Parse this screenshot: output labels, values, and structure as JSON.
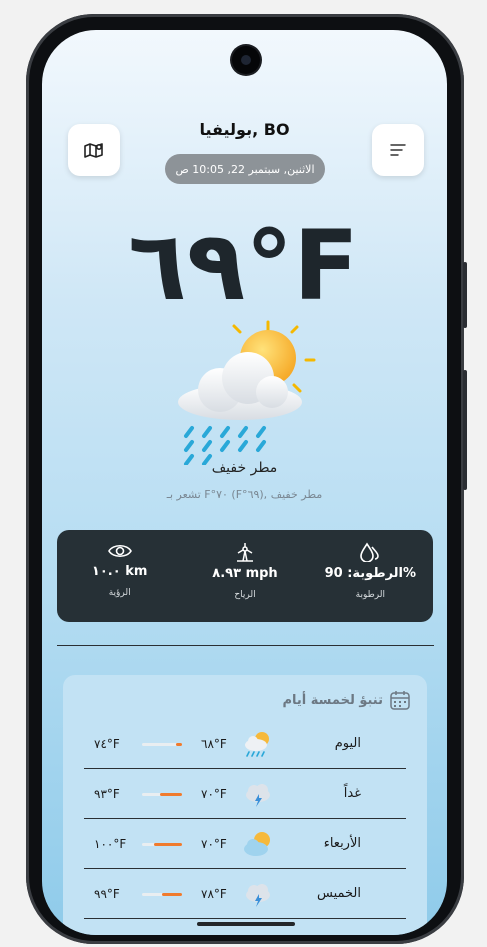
{
  "header": {
    "city": "بوليفيا, BO",
    "datetime": "الاثنين, سبتمبر 22, 10:05 ص",
    "map_icon": "map-icon",
    "menu_icon": "menu-lines-icon"
  },
  "current": {
    "temperature": "٦٩°F",
    "condition": "مطر خفيف",
    "feels_like": "تشعر بـ F°٧٠ (F°٦٩), مطر خفيف",
    "icon": "sun-cloud-rain-icon"
  },
  "stats": [
    {
      "icon": "eye-icon",
      "value": "١٠.٠ km",
      "label": "الرؤية"
    },
    {
      "icon": "wind-icon",
      "value": "٨.٩٣ mph",
      "label": "الرياح"
    },
    {
      "icon": "humidity-icon",
      "value": "الرطوبة: 90%",
      "label": "الرطوبة"
    }
  ],
  "forecast": {
    "title": "تنبؤ لخمسة أيام",
    "title_icon": "calendar-icon",
    "days": [
      {
        "day": "اليوم",
        "min": "٦٨°F",
        "max": "٧٤°F",
        "icon": "sun-cloud-rain-icon",
        "range_fraction": 0.15
      },
      {
        "day": "غداً",
        "min": "٧٠°F",
        "max": "٩٣°F",
        "icon": "thunder-cloud-icon",
        "range_fraction": 0.55
      },
      {
        "day": "الأربعاء",
        "min": "٧٠°F",
        "max": "١٠٠°F",
        "icon": "sun-cloud-icon",
        "range_fraction": 0.7
      },
      {
        "day": "الخميس",
        "min": "٧٨°F",
        "max": "٩٩°F",
        "icon": "thunder-cloud-icon",
        "range_fraction": 0.5
      }
    ]
  },
  "colors": {
    "accent": "#f07b2d",
    "stats_bg": "#263036",
    "pill_bg": "#8d9398"
  }
}
